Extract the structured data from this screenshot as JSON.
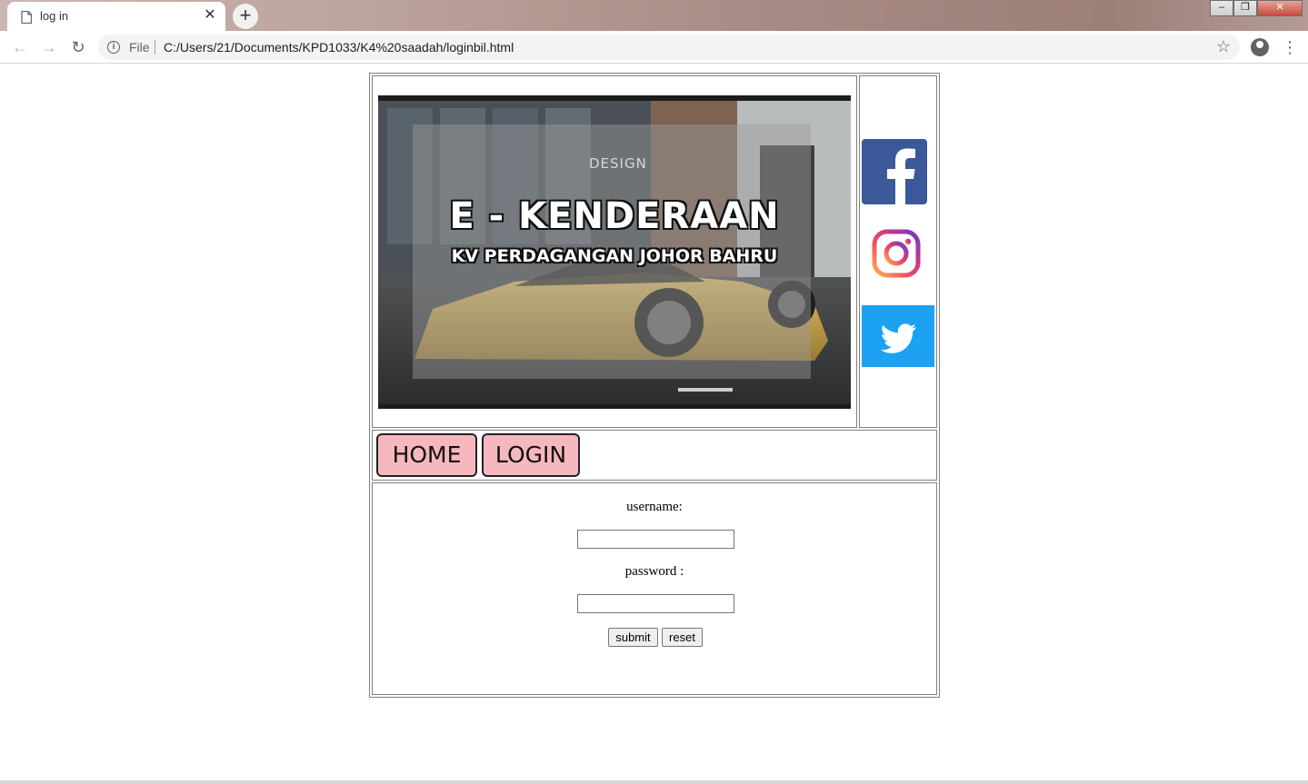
{
  "browser": {
    "tab_title": "log in",
    "tab_close": "✕",
    "new_tab": "+",
    "window_buttons": {
      "minimize": "–",
      "maximize": "❐",
      "close": "✕"
    },
    "scheme_label": "File",
    "url": "C:/Users/21/Documents/KPD1033/K4%20saadah/loginbil.html",
    "nav_icons": {
      "back": "←",
      "forward": "→",
      "reload": "↻",
      "bookmark": "☆",
      "menu": "⋮",
      "info": "i"
    }
  },
  "banner": {
    "title": "E - KENDERAAN",
    "subtitle": "KV PERDAGANGAN JOHOR BAHRU",
    "watermark": "DESIGN"
  },
  "social": {
    "facebook_icon": "facebook-icon",
    "instagram_icon": "instagram-icon",
    "twitter_icon": "twitter-icon",
    "colors": {
      "facebook": "#3b5998",
      "twitter": "#1da1f2"
    }
  },
  "nav": {
    "home_label": "HOME",
    "login_label": "LOGIN",
    "button_color": "#f7b7bf"
  },
  "form": {
    "username_label": "username:",
    "password_label": "password :",
    "username_value": "",
    "password_value": "",
    "submit_label": "submit",
    "reset_label": "reset"
  }
}
